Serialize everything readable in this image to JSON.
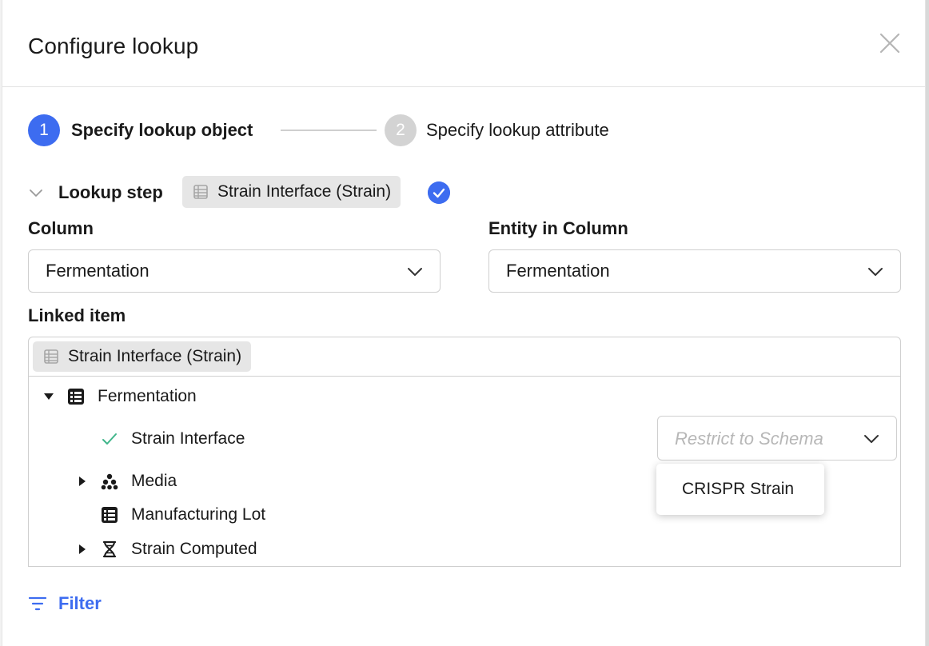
{
  "dialog": {
    "title": "Configure lookup"
  },
  "stepper": {
    "steps": [
      {
        "number": "1",
        "label": "Specify lookup object",
        "state": "active"
      },
      {
        "number": "2",
        "label": "Specify lookup attribute",
        "state": "inactive"
      }
    ]
  },
  "lookup_step": {
    "label": "Lookup step",
    "chip_label": "Strain Interface (Strain)",
    "chip_icon": "table-icon",
    "status": "complete"
  },
  "column_field": {
    "label": "Column",
    "value": "Fermentation"
  },
  "entity_field": {
    "label": "Entity in Column",
    "value": "Fermentation"
  },
  "linked_item": {
    "label": "Linked item",
    "chip_label": "Strain Interface (Strain)"
  },
  "tree": {
    "root": {
      "label": "Fermentation",
      "expanded": true,
      "icon": "table-icon"
    },
    "children": [
      {
        "label": "Strain Interface",
        "icon": "check-icon",
        "selected": true
      },
      {
        "label": "Media",
        "icon": "molecule-icon",
        "expandable": true
      },
      {
        "label": "Manufacturing Lot",
        "icon": "table-icon",
        "expandable": false
      },
      {
        "label": "Strain Computed",
        "icon": "dna-icon",
        "expandable": true
      }
    ]
  },
  "restrict_schema": {
    "placeholder": "Restrict to Schema",
    "options": [
      "CRISPR Strain"
    ]
  },
  "filter": {
    "label": "Filter"
  },
  "colors": {
    "accent": "#3d6cf0",
    "check_green": "#3fb58a",
    "chip_bg": "#e6e6e6",
    "border": "#cfcfcf"
  }
}
